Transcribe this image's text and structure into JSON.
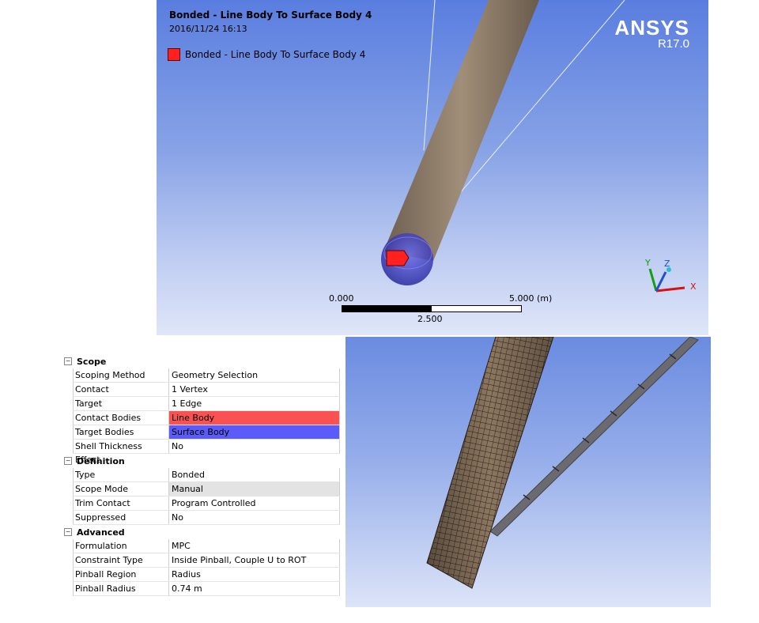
{
  "viewport": {
    "title": "Bonded - Line Body To Surface Body 4",
    "timestamp": "2016/11/24 16:13",
    "legend_label": "Bonded - Line Body To Surface Body 4",
    "legend_color": "#ff2020",
    "logo": "ANSYS",
    "version": "R17.0",
    "scale": {
      "start": "0.000",
      "end": "5.000 (m)",
      "mid": "2.500"
    },
    "triad": {
      "x": "X",
      "y": "Y",
      "z": "Z"
    }
  },
  "details": {
    "sections": [
      {
        "title": "Scope",
        "rows": [
          {
            "name": "Scoping Method",
            "value": "Geometry Selection"
          },
          {
            "name": "Contact",
            "value": "1 Vertex"
          },
          {
            "name": "Target",
            "value": "1 Edge"
          },
          {
            "name": "Contact Bodies",
            "value": "Line Body"
          },
          {
            "name": "Target Bodies",
            "value": "Surface Body"
          },
          {
            "name": "Shell Thickness Effect",
            "value": "No"
          }
        ]
      },
      {
        "title": "Definition",
        "rows": [
          {
            "name": "Type",
            "value": "Bonded"
          },
          {
            "name": "Scope Mode",
            "value": "Manual"
          },
          {
            "name": "Trim Contact",
            "value": "Program Controlled"
          },
          {
            "name": "Suppressed",
            "value": "No"
          }
        ]
      },
      {
        "title": "Advanced",
        "rows": [
          {
            "name": "Formulation",
            "value": "MPC"
          },
          {
            "name": "Constraint Type",
            "value": "Inside Pinball, Couple U to ROT"
          },
          {
            "name": "Pinball Region",
            "value": "Radius"
          },
          {
            "name": "Pinball Radius",
            "value": "0.74 m"
          }
        ]
      }
    ],
    "colors": {
      "contact": "#fa5252",
      "target": "#5b5bfa"
    }
  }
}
